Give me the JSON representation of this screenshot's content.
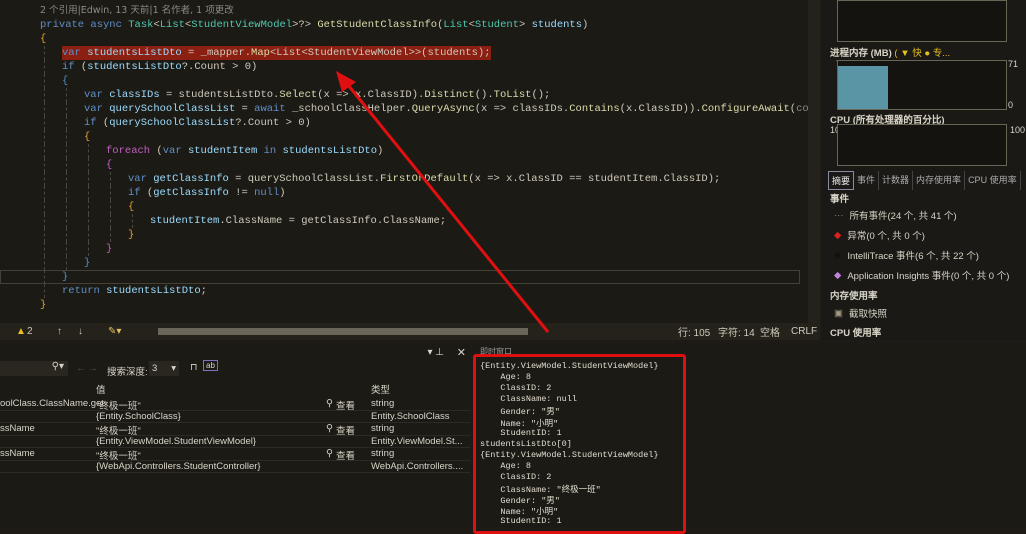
{
  "editor": {
    "codelens": "2 个引用|Edwin, 13 天前|1 名作者, 1 项更改",
    "lines": [
      [
        [
          "kw",
          "private async "
        ],
        [
          "ty",
          "Task"
        ],
        [
          "pl",
          "<"
        ],
        [
          "ty",
          "List"
        ],
        [
          "pl",
          "<"
        ],
        [
          "ty",
          "StudentViewModel"
        ],
        [
          "pl",
          ">?> "
        ],
        [
          "fn",
          "GetStudentClassInfo"
        ],
        [
          "pl",
          "("
        ],
        [
          "ty",
          "List"
        ],
        [
          "pl",
          "<"
        ],
        [
          "ty",
          "Student"
        ],
        [
          "pl",
          "> "
        ],
        [
          "id",
          "students"
        ],
        [
          "pl",
          ")"
        ]
      ],
      [
        [
          "br",
          "{"
        ]
      ],
      [
        [
          "kw",
          "var "
        ],
        [
          "id",
          "studentsListDto"
        ],
        [
          "pl",
          " = _mapper."
        ],
        [
          "fn",
          "Map"
        ],
        [
          "pl",
          "<List<StudentViewModel>>(students);"
        ]
      ],
      [
        [
          "kw",
          "if "
        ],
        [
          "pl",
          "("
        ],
        [
          "id",
          "studentsListDto"
        ],
        [
          "pl",
          "?.Count > 0)"
        ]
      ],
      [
        [
          "br3",
          "{"
        ]
      ],
      [
        [
          "kw",
          "var "
        ],
        [
          "id",
          "classIDs"
        ],
        [
          "pl",
          " = studentsListDto."
        ],
        [
          "fn",
          "Select"
        ],
        [
          "pl",
          "(x => x.ClassID)."
        ],
        [
          "fn",
          "Distinct"
        ],
        [
          "pl",
          "()."
        ],
        [
          "fn",
          "ToList"
        ],
        [
          "pl",
          "();"
        ]
      ],
      [
        [
          "kw",
          "var "
        ],
        [
          "id",
          "querySchoolClassList"
        ],
        [
          "pl",
          " = "
        ],
        [
          "kw",
          "await "
        ],
        [
          "pl",
          "_schoolClassHelper."
        ],
        [
          "fn",
          "QueryAsync"
        ],
        [
          "pl",
          "(x => classIDs."
        ],
        [
          "fn",
          "Contains"
        ],
        [
          "pl",
          "(x.ClassID))."
        ],
        [
          "fn",
          "ConfigureAwait"
        ],
        [
          "pl",
          "("
        ],
        [
          "cm",
          "continueOnCapture"
        ]
      ],
      [
        [
          "kw",
          "if "
        ],
        [
          "pl",
          "("
        ],
        [
          "id",
          "querySchoolClassList"
        ],
        [
          "pl",
          "?.Count > 0)"
        ]
      ],
      [
        [
          "br",
          "{"
        ]
      ],
      [
        [
          "br2",
          "foreach "
        ],
        [
          "pl",
          "("
        ],
        [
          "kw",
          "var "
        ],
        [
          "id",
          "studentItem"
        ],
        [
          "kw",
          " in "
        ],
        [
          "id",
          "studentsListDto"
        ],
        [
          "pl",
          ")"
        ]
      ],
      [
        [
          "br2",
          "{"
        ]
      ],
      [
        [
          "kw",
          "var "
        ],
        [
          "id",
          "getClassInfo"
        ],
        [
          "pl",
          " = querySchoolClassList."
        ],
        [
          "fn",
          "FirstOrDefault"
        ],
        [
          "pl",
          "(x => x.ClassID == studentItem.ClassID);"
        ]
      ],
      [
        [
          "kw",
          "if "
        ],
        [
          "pl",
          "("
        ],
        [
          "id",
          "getClassInfo"
        ],
        [
          "pl",
          " != "
        ],
        [
          "kw",
          "null"
        ],
        [
          "pl",
          ")"
        ]
      ],
      [
        [
          "br",
          "{"
        ]
      ],
      [
        [
          "id",
          "studentItem"
        ],
        [
          "pl",
          ".ClassName = getClassInfo.ClassName;"
        ]
      ],
      [
        [
          "br",
          "}"
        ]
      ],
      [
        [
          "br2",
          "}"
        ]
      ],
      [
        [
          "br3",
          "}"
        ]
      ],
      [
        [
          "br3",
          "}"
        ]
      ],
      [
        [
          "kw",
          "return "
        ],
        [
          "id",
          "studentsListDto"
        ],
        [
          "pl",
          ";"
        ]
      ],
      [
        [
          "br",
          "}"
        ]
      ]
    ],
    "indents": [
      0,
      0,
      1,
      1,
      1,
      2,
      2,
      2,
      2,
      3,
      3,
      4,
      4,
      4,
      5,
      4,
      3,
      2,
      1,
      1,
      0
    ]
  },
  "statusbar": {
    "warnings": "2",
    "line": "行: 105",
    "char": "字符: 14",
    "spaces": "空格",
    "eol": "CRLF"
  },
  "diagnostics": {
    "memory_title": "进程内存 (MB)",
    "memory_legend": "( ▼ 快 ● 专...",
    "mem_max": "71",
    "mem_min": "0",
    "mem_fill_percent": 30,
    "cpu_title": "CPU (所有处理器的百分比)",
    "cpu_max": "100",
    "tabs": [
      "摘要",
      "事件",
      "计数器",
      "内存使用率",
      "CPU 使用率"
    ],
    "events_header": "事件",
    "events": [
      {
        "icon": "all-events-icon",
        "color": "#888888",
        "label": "所有事件(24 个, 共 41 个)"
      },
      {
        "icon": "exception-icon",
        "color": "#e02020",
        "label": "异常(0 个, 共 0 个)"
      },
      {
        "icon": "intellitrace-icon",
        "color": "#000000",
        "label": "IntelliTrace 事件(6 个, 共 22 个)"
      },
      {
        "icon": "app-insights-icon",
        "color": "#c080e0",
        "label": "Application Insights 事件(0 个, 共 0 个)"
      }
    ],
    "memory_header": "内存使用率",
    "snapshot": "截取快照",
    "cpu_header": "CPU 使用率"
  },
  "locals": {
    "search_depth_label": "搜索深度:",
    "search_depth": "3",
    "col_value": "值",
    "col_type": "类型",
    "view": "查看",
    "rows": [
      {
        "name": "oolClass.ClassName.get",
        "value": "\"终极一班\"",
        "type": "string",
        "view": true
      },
      {
        "name": "",
        "value": "{Entity.SchoolClass}",
        "type": "Entity.SchoolClass",
        "view": false
      },
      {
        "name": "ssName",
        "value": "\"终极一班\"",
        "type": "string",
        "view": true
      },
      {
        "name": "",
        "value": "{Entity.ViewModel.StudentViewModel}",
        "type": "Entity.ViewModel.St...",
        "view": false
      },
      {
        "name": "ssName",
        "value": "\"终极一班\"",
        "type": "string",
        "view": true
      },
      {
        "name": "",
        "value": "{WebApi.Controllers.StudentController}",
        "type": "WebApi.Controllers....",
        "view": false
      }
    ]
  },
  "immediate": {
    "title": "即时窗口",
    "lines": [
      "{Entity.ViewModel.StudentViewModel}",
      "    Age: 8",
      "    ClassID: 2",
      "    ClassName: null",
      "    Gender: \"男\"",
      "    Name: \"小明\"",
      "    StudentID: 1",
      "studentsListDto[0]",
      "{Entity.ViewModel.StudentViewModel}",
      "    Age: 8",
      "    ClassID: 2",
      "    ClassName: \"终极一班\"",
      "    Gender: \"男\"",
      "    Name: \"小明\"",
      "    StudentID: 1"
    ]
  },
  "annotation_color": "#e01010"
}
